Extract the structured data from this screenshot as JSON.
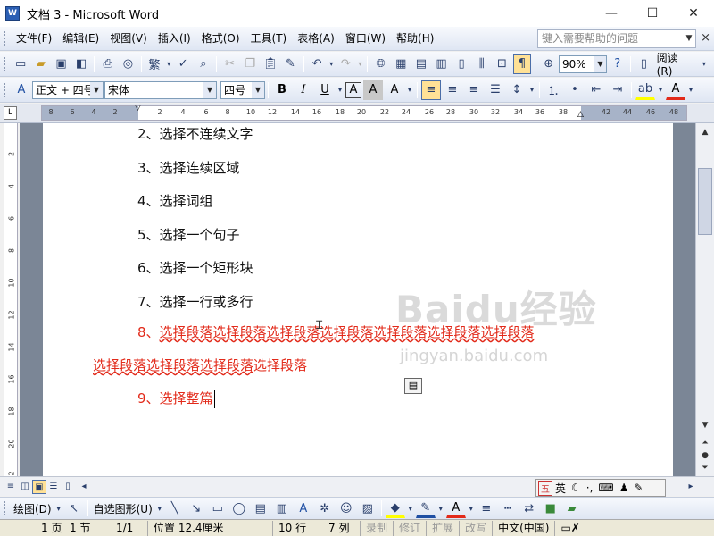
{
  "window": {
    "title": "文档 3 - Microsoft Word",
    "app_icon": "W",
    "minimize": "—",
    "maximize": "☐",
    "close": "✕"
  },
  "menubar": {
    "items": [
      "文件(F)",
      "编辑(E)",
      "视图(V)",
      "插入(I)",
      "格式(O)",
      "工具(T)",
      "表格(A)",
      "窗口(W)",
      "帮助(H)"
    ],
    "help_placeholder": "键入需要帮助的问题",
    "doc_close": "×"
  },
  "standard_toolbar": {
    "zoom": "90%",
    "read_label": "阅读(R)",
    "traditional_char": "繁"
  },
  "format_toolbar": {
    "style": "正文 + 四号",
    "font": "宋体",
    "size": "四号",
    "bold": "B",
    "italic": "I",
    "underline": "U",
    "a_box": "A",
    "a_shadow": "A",
    "font_color": "A"
  },
  "ruler": {
    "ticks": [
      "8",
      "6",
      "4",
      "2",
      "2",
      "4",
      "6",
      "8",
      "10",
      "12",
      "14",
      "16",
      "18",
      "20",
      "22",
      "24",
      "26",
      "28",
      "30",
      "32",
      "34",
      "36",
      "38",
      "42",
      "44",
      "46",
      "48"
    ],
    "vticks": [
      "2",
      "4",
      "6",
      "8",
      "10",
      "12",
      "14",
      "16",
      "18",
      "20",
      "22"
    ],
    "corner": "L"
  },
  "document": {
    "lines": [
      {
        "text": "2、选择不连续文字",
        "red": false
      },
      {
        "text": "3、选择连续区域",
        "red": false
      },
      {
        "text": "4、选择词组",
        "red": false
      },
      {
        "text": "5、选择一个句子",
        "red": false
      },
      {
        "text": "6、选择一个矩形块",
        "red": false
      },
      {
        "text": "7、选择一行或多行",
        "red": false
      }
    ],
    "item8_prefix": "8、",
    "item8_line1": "选择段落选择段落选择段落选择段落选择段落选择段落选择段落",
    "item8_line2_underlined": "选择段落选择段落选择段落",
    "item8_line2_rest": "选择段落",
    "item9": "9、选择整篇",
    "watermark": "Baidu经验",
    "watermark_url": "jingyan.baidu.com"
  },
  "ime": {
    "lang": "英",
    "logo": "五"
  },
  "drawing_toolbar": {
    "draw_label": "绘图(D)",
    "autoshape_label": "自选图形(U)"
  },
  "status": {
    "page": "1 页",
    "section": "1 节",
    "pages": "1/1",
    "position": "位置 12.4厘米",
    "row": "10 行",
    "col": "7 列",
    "rec": "录制",
    "trk": "修订",
    "ext": "扩展",
    "ovr": "改写",
    "lang": "中文(中国)"
  },
  "colors": {
    "red_text": "#e22a1a",
    "highlight": "#ffe196",
    "accent": "#2b5fb4"
  }
}
